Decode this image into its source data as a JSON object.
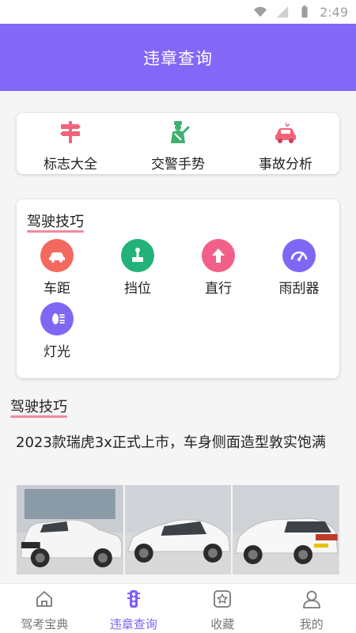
{
  "status_bar": {
    "time": "2:49",
    "icons": [
      "wifi-icon",
      "signal-icon",
      "battery-icon"
    ]
  },
  "header": {
    "title": "违章查询"
  },
  "tools": [
    {
      "label": "标志大全",
      "icon": "signpost-icon",
      "color": "#f2637b"
    },
    {
      "label": "交警手势",
      "icon": "traffic-police-icon",
      "color": "#3fb06f"
    },
    {
      "label": "事故分析",
      "icon": "car-accident-icon",
      "color": "#f2637b"
    }
  ],
  "skills_card": {
    "title": "驾驶技巧",
    "items": [
      {
        "label": "车距",
        "icon": "car-distance-icon",
        "color": "#f26a5f"
      },
      {
        "label": "挡位",
        "icon": "gear-shift-icon",
        "color": "#22b27a"
      },
      {
        "label": "直行",
        "icon": "arrow-up-icon",
        "color": "#f2608a"
      },
      {
        "label": "雨刮器",
        "icon": "wiper-icon",
        "color": "#7f67f4"
      },
      {
        "label": "灯光",
        "icon": "headlight-icon",
        "color": "#7f67f4"
      }
    ]
  },
  "articles": {
    "title": "驾驶技巧",
    "items": [
      {
        "title": "2023款瑞虎3x正式上市，车身侧面造型敦实饱满"
      }
    ]
  },
  "tab_bar": {
    "tabs": [
      {
        "label": "驾考宝典",
        "icon": "home-icon",
        "active": false
      },
      {
        "label": "违章查询",
        "icon": "traffic-light-icon",
        "active": true
      },
      {
        "label": "收藏",
        "icon": "star-box-icon",
        "active": false
      },
      {
        "label": "我的",
        "icon": "user-icon",
        "active": false
      }
    ]
  },
  "colors": {
    "accent": "#8367f7",
    "underline": "#f08a9e",
    "active_tab": "#7d5ff5"
  }
}
